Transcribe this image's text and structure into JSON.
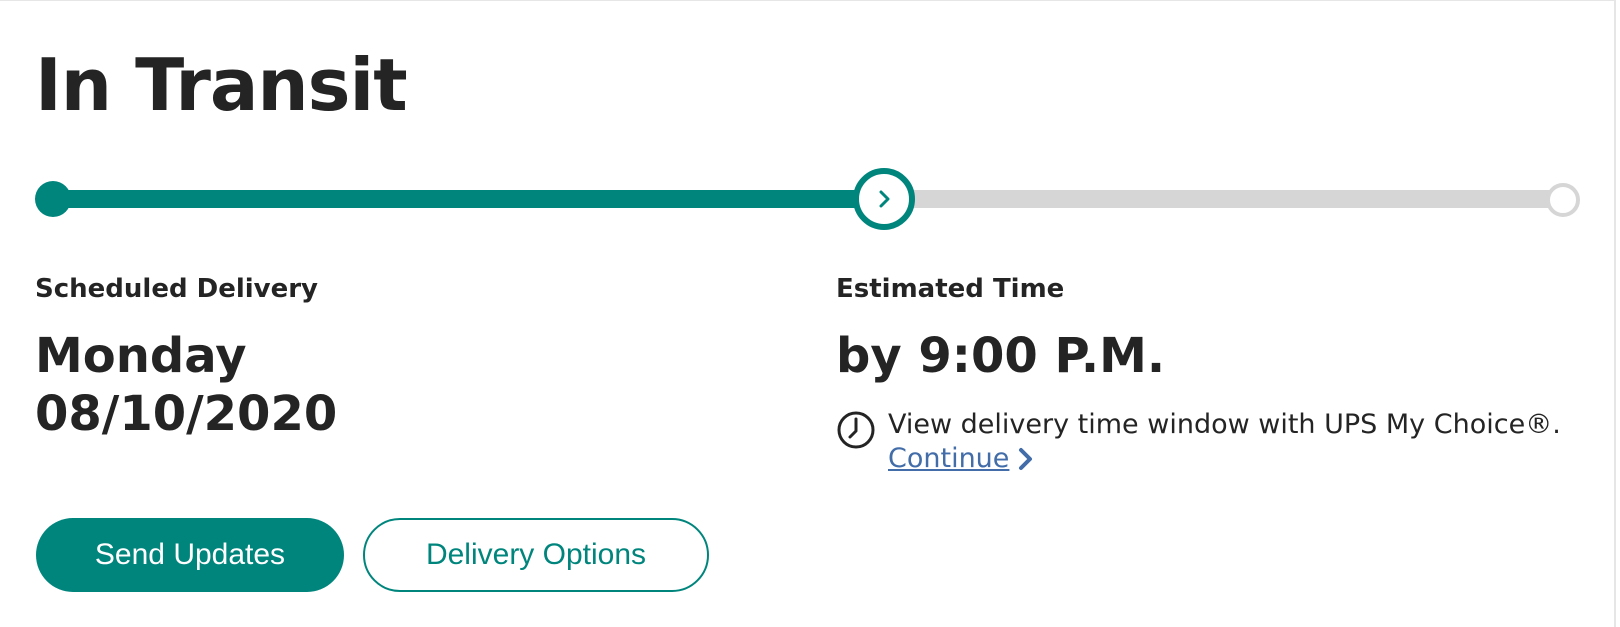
{
  "status": {
    "title": "In Transit"
  },
  "progress": {
    "steps": 3,
    "current_step": 2,
    "filled_fraction": 0.55
  },
  "scheduled": {
    "label": "Scheduled Delivery",
    "day": "Monday",
    "date": "08/10/2020"
  },
  "estimated": {
    "label": "Estimated Time",
    "time": "by 9:00 P.M.",
    "window_text": "View delivery time window with UPS My Choice®.",
    "continue_label": "Continue "
  },
  "actions": {
    "send_updates": "Send Updates",
    "delivery_options": "Delivery Options"
  },
  "icons": {
    "current_step": "chevron-right-icon",
    "window": "clock-icon",
    "continue": "chevron-right-icon"
  },
  "colors": {
    "accent": "#00857d",
    "track": "#d6d6d6",
    "link": "#426da9",
    "text": "#242424"
  }
}
